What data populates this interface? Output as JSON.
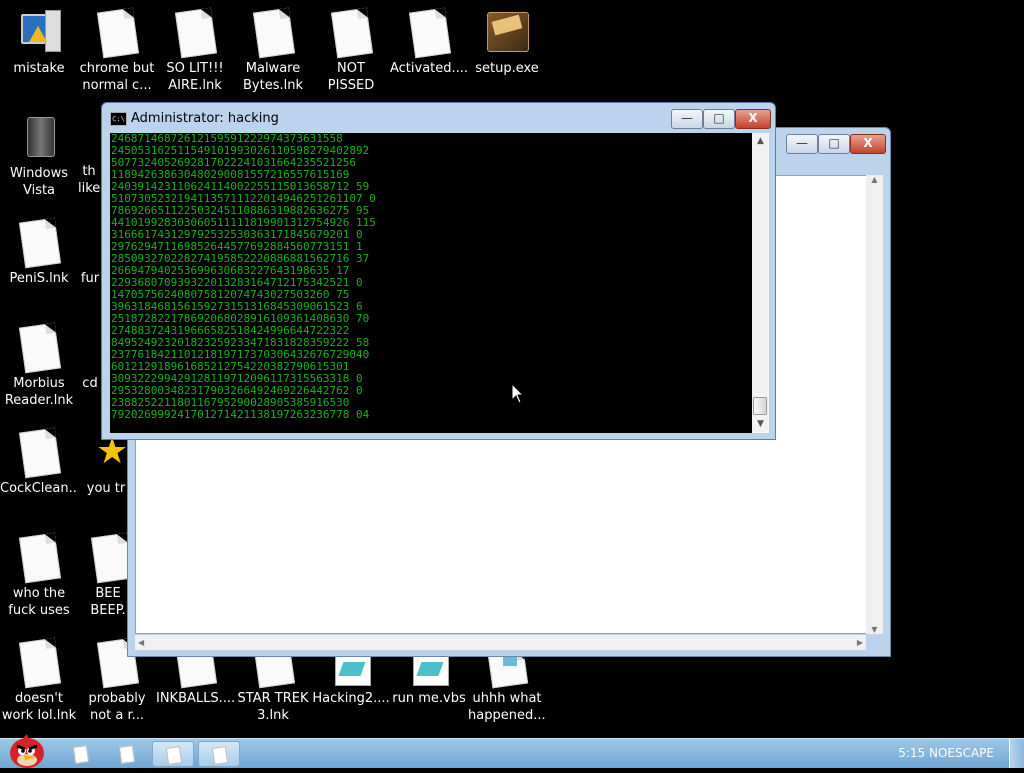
{
  "desktop_icons": [
    {
      "name": "mistake",
      "label": "mistake"
    },
    {
      "name": "chrome",
      "label": "chrome but normal c..."
    },
    {
      "name": "solit",
      "label": "SO LIT!!! AIRE.lnk"
    },
    {
      "name": "malware",
      "label": "Malware Bytes.lnk"
    },
    {
      "name": "notpissed",
      "label": "NOT PISSED BIRD GAM..."
    },
    {
      "name": "activated",
      "label": "Activated...."
    },
    {
      "name": "setup",
      "label": "setup.exe"
    },
    {
      "name": "vista",
      "label": "Windows Vista"
    },
    {
      "name": "th",
      "label": "th like"
    },
    {
      "name": "penis",
      "label": "PeniS.lnk"
    },
    {
      "name": "fur",
      "label": "fur"
    },
    {
      "name": "morbius",
      "label": "Morbius Reader.lnk"
    },
    {
      "name": "cd",
      "label": "cd"
    },
    {
      "name": "cockclean",
      "label": "CockClean..."
    },
    {
      "name": "youtr",
      "label": "you tr"
    },
    {
      "name": "whothe",
      "label": "who the fuck uses this.lnk"
    },
    {
      "name": "beep",
      "label": "BEE BEEP."
    },
    {
      "name": "doesnt",
      "label": "doesn't work lol.lnk"
    },
    {
      "name": "probably",
      "label": "probably not a r..."
    },
    {
      "name": "inkballs",
      "label": "INKBALLS...."
    },
    {
      "name": "startrek",
      "label": "STAR TREK 3.lnk"
    },
    {
      "name": "hacking2",
      "label": "Hacking2...."
    },
    {
      "name": "runme",
      "label": "run me.vbs"
    },
    {
      "name": "uhhh",
      "label": "uhhh what happened...."
    }
  ],
  "cmd_window": {
    "title": "Administrator:  hacking",
    "min_label": "—",
    "max_label": "□",
    "close_label": "X",
    "lines": [
      "24687146872612159591222974373631558",
      "245053162511549101993026110598279402892",
      "5077324052692817022241031664235521256",
      "118942638630480290081557216557615169",
      "240391423110624114002255115013658712 59",
      "51073052321941135711122014946251261107 0",
      "786926651122503245110886319882636275 95",
      "441019928303060511111819901312754926 115",
      "316661743129792532530363171845679201 0",
      "297629471169852644577692884560773151 1",
      "285093270228274195852220886881562716 37",
      "266947940253699630683227643198635 17",
      "229368070939322013283164712175342521 0",
      "147057562408075812074743027503260 75",
      "396318468156159273151316845309061523 6",
      "251872822178692068028916109361408630 70",
      "274883724319666582518424996644722322",
      "849524923201823259233471831828359222 58",
      "237761842110121819717370306432676729040",
      "601212918961685212754220382790615301",
      "309322299429128119712096117315563318 0",
      "295328003482317903266492469226442762 0",
      "238825221180116795290028905385916530",
      "792026999241701271421138197263236778 04"
    ],
    "scroll_up": "▲",
    "scroll_down": "▼"
  },
  "explorer_window": {
    "min_label": "—",
    "max_label": "□",
    "close_label": "X",
    "scroll_up": "▲",
    "scroll_down": "▼",
    "scroll_left": "◀",
    "scroll_right": "▶"
  },
  "taskbar": {
    "clock": "5:15 NOESCAPE"
  }
}
